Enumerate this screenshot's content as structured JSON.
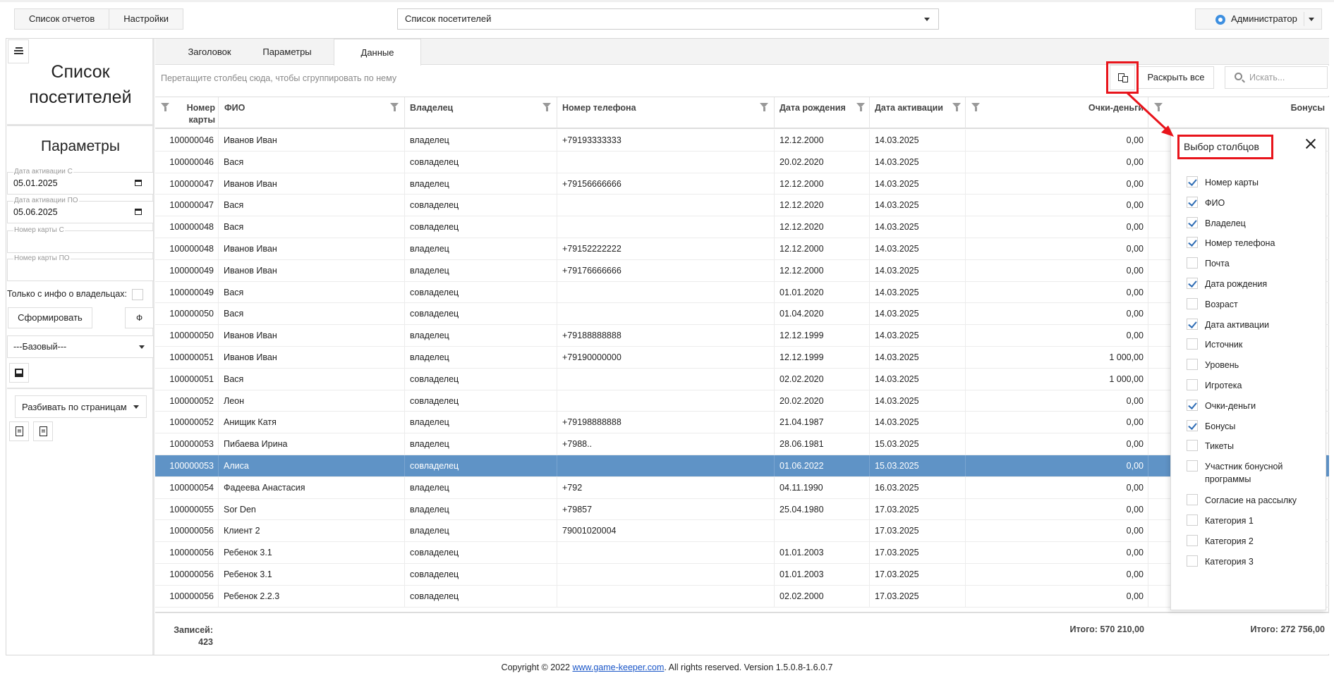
{
  "topbar": {
    "reports_button": "Список отчетов",
    "settings_button": "Настройки",
    "report_select": "Список посетителей",
    "admin_label": "Администратор"
  },
  "left": {
    "title": "Список посетителей",
    "params_title": "Параметры",
    "fields": [
      {
        "label": "Дата активации С",
        "value": "05.01.2025"
      },
      {
        "label": "Дата активации ПО",
        "value": "05.06.2025"
      },
      {
        "label": "Номер карты С",
        "value": ""
      },
      {
        "label": "Номер карты ПО",
        "value": ""
      }
    ],
    "owners_only_label": "Только с инфо о владельцах:",
    "form_button": "Сформировать",
    "phi_button": "Ф",
    "preset_select": "---Базовый---",
    "paging_select": "Разбивать по страницам"
  },
  "tabs": [
    "Заголовок",
    "Параметры",
    "Данные"
  ],
  "active_tab": "Данные",
  "toolbar": {
    "group_hint": "Перетащите столбец сюда, чтобы сгруппировать по нему",
    "expand_all": "Раскрыть все",
    "search_placeholder": "Искать..."
  },
  "columns": [
    "Номер карты",
    "ФИО",
    "Владелец",
    "Номер телефона",
    "Дата рождения",
    "Дата активации",
    "Очки-деньги",
    "Бонусы"
  ],
  "rows": [
    [
      "100000046",
      "Иванов Иван",
      "владелец",
      "+79193333333",
      "12.12.2000",
      "14.03.2025",
      "0,00"
    ],
    [
      "100000046",
      "Вася",
      "совладелец",
      "",
      "20.02.2020",
      "14.03.2025",
      "0,00"
    ],
    [
      "100000047",
      "Иванов Иван",
      "владелец",
      "+79156666666",
      "12.12.2000",
      "14.03.2025",
      "0,00"
    ],
    [
      "100000047",
      "Вася",
      "совладелец",
      "",
      "12.12.2020",
      "14.03.2025",
      "0,00"
    ],
    [
      "100000048",
      "Вася",
      "совладелец",
      "",
      "12.12.2020",
      "14.03.2025",
      "0,00"
    ],
    [
      "100000048",
      "Иванов Иван",
      "владелец",
      "+79152222222",
      "12.12.2000",
      "14.03.2025",
      "0,00"
    ],
    [
      "100000049",
      "Иванов Иван",
      "владелец",
      "+79176666666",
      "12.12.2000",
      "14.03.2025",
      "0,00"
    ],
    [
      "100000049",
      "Вася",
      "совладелец",
      "",
      "01.01.2020",
      "14.03.2025",
      "0,00"
    ],
    [
      "100000050",
      "Вася",
      "совладелец",
      "",
      "01.04.2020",
      "14.03.2025",
      "0,00"
    ],
    [
      "100000050",
      "Иванов Иван",
      "владелец",
      "+79188888888",
      "12.12.1999",
      "14.03.2025",
      "0,00"
    ],
    [
      "100000051",
      "Иванов Иван",
      "владелец",
      "+79190000000",
      "12.12.1999",
      "14.03.2025",
      "1 000,00"
    ],
    [
      "100000051",
      "Вася",
      "совладелец",
      "",
      "02.02.2020",
      "14.03.2025",
      "1 000,00"
    ],
    [
      "100000052",
      "Леон",
      "совладелец",
      "",
      "20.02.2020",
      "14.03.2025",
      "0,00"
    ],
    [
      "100000052",
      "Анищик Катя",
      "владелец",
      "+79198888888",
      "21.04.1987",
      "14.03.2025",
      "0,00"
    ],
    [
      "100000053",
      "Пибаева Ирина",
      "владелец",
      "+7988..",
      "28.06.1981",
      "15.03.2025",
      "0,00"
    ],
    [
      "100000053",
      "Алиса",
      "совладелец",
      "",
      "01.06.2022",
      "15.03.2025",
      "0,00"
    ],
    [
      "100000054",
      "Фадеева Анастасия",
      "владелец",
      "+792",
      "04.11.1990",
      "16.03.2025",
      "0,00"
    ],
    [
      "100000055",
      "Sor Den",
      "владелец",
      "+79857",
      "25.04.1980",
      "17.03.2025",
      "0,00"
    ],
    [
      "100000056",
      "Клиент 2",
      "владелец",
      "79001020004",
      "",
      "17.03.2025",
      "0,00"
    ],
    [
      "100000056",
      "Ребенок 3.1",
      "совладелец",
      "",
      "01.01.2003",
      "17.03.2025",
      "0,00"
    ],
    [
      "100000056",
      "Ребенок 3.1",
      "совладелец",
      "",
      "01.01.2003",
      "17.03.2025",
      "0,00"
    ],
    [
      "100000056",
      "Ребенок 2.2.3",
      "совладелец",
      "",
      "02.02.2000",
      "17.03.2025",
      "0,00"
    ]
  ],
  "selected_row": 15,
  "footer": {
    "records_label": "Записей:",
    "records_count": "423",
    "total_points": "Итого: 570 210,00",
    "total_bonus": "Итого: 272 756,00"
  },
  "column_chooser": {
    "title": "Выбор столбцов",
    "options": [
      {
        "label": "Номер карты",
        "checked": true
      },
      {
        "label": "ФИО",
        "checked": true
      },
      {
        "label": "Владелец",
        "checked": true
      },
      {
        "label": "Номер телефона",
        "checked": true
      },
      {
        "label": "Почта",
        "checked": false
      },
      {
        "label": "Дата рождения",
        "checked": true
      },
      {
        "label": "Возраст",
        "checked": false
      },
      {
        "label": "Дата активации",
        "checked": true
      },
      {
        "label": "Источник",
        "checked": false
      },
      {
        "label": "Уровень",
        "checked": false
      },
      {
        "label": "Игротека",
        "checked": false
      },
      {
        "label": "Очки-деньги",
        "checked": true
      },
      {
        "label": "Бонусы",
        "checked": true
      },
      {
        "label": "Тикеты",
        "checked": false
      },
      {
        "label": "Участник бонусной программы",
        "checked": false
      },
      {
        "label": "Согласие на рассылку",
        "checked": false
      },
      {
        "label": "Категория 1",
        "checked": false
      },
      {
        "label": "Категория 2",
        "checked": false
      },
      {
        "label": "Категория 3",
        "checked": false
      }
    ]
  },
  "copyright": {
    "prefix": "Copyright © 2022 ",
    "link": "www.game-keeper.com",
    "suffix": ". All rights reserved.  Version 1.5.0.8-1.6.0.7"
  },
  "colors": {
    "selected_row": "#5f93c6",
    "annotation": "#e8141b",
    "link": "#1a56c8"
  }
}
